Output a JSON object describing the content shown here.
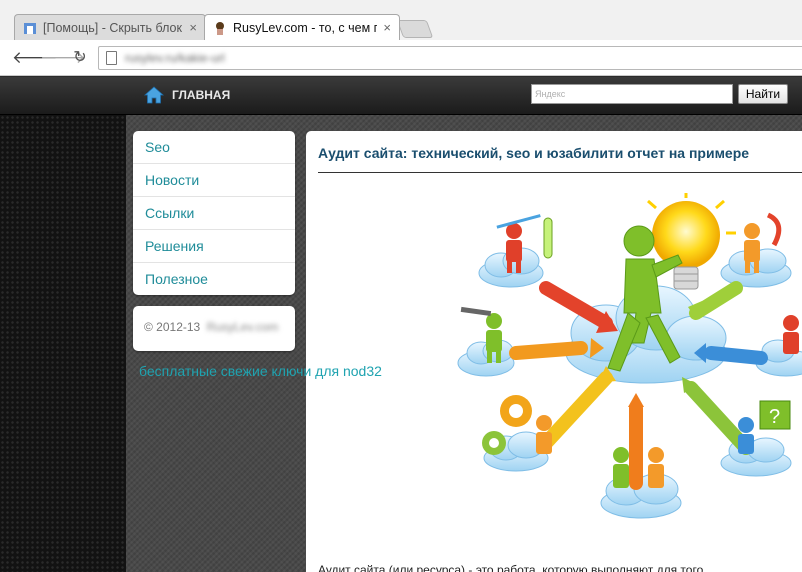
{
  "browser": {
    "tabs": [
      {
        "title": "[Помощь] - Скрыть блок",
        "close": "×",
        "active": false
      },
      {
        "title": "RusyLev.com - то, с чем п",
        "close": "×",
        "active": true
      }
    ],
    "url": "rusylev.ru/kakie-url"
  },
  "header": {
    "home_label": "ГЛАВНАЯ",
    "search_placeholder": "Яндекс",
    "search_button": "Найти"
  },
  "sidebar": {
    "menu": [
      {
        "label": "Seo"
      },
      {
        "label": "Новости"
      },
      {
        "label": "Ссылки"
      },
      {
        "label": "Решения"
      },
      {
        "label": "Полезное"
      }
    ],
    "copyright": "© 2012-13",
    "copyright_owner": "RusyLev.com",
    "promo_link": "бесплатные свежие ключи для nod32"
  },
  "article": {
    "title": "Аудит сайта: технический, seo и юзабилити отчет на примере",
    "text": "Аудит сайта (или ресурса) - это работа, которую выполняют для того"
  }
}
